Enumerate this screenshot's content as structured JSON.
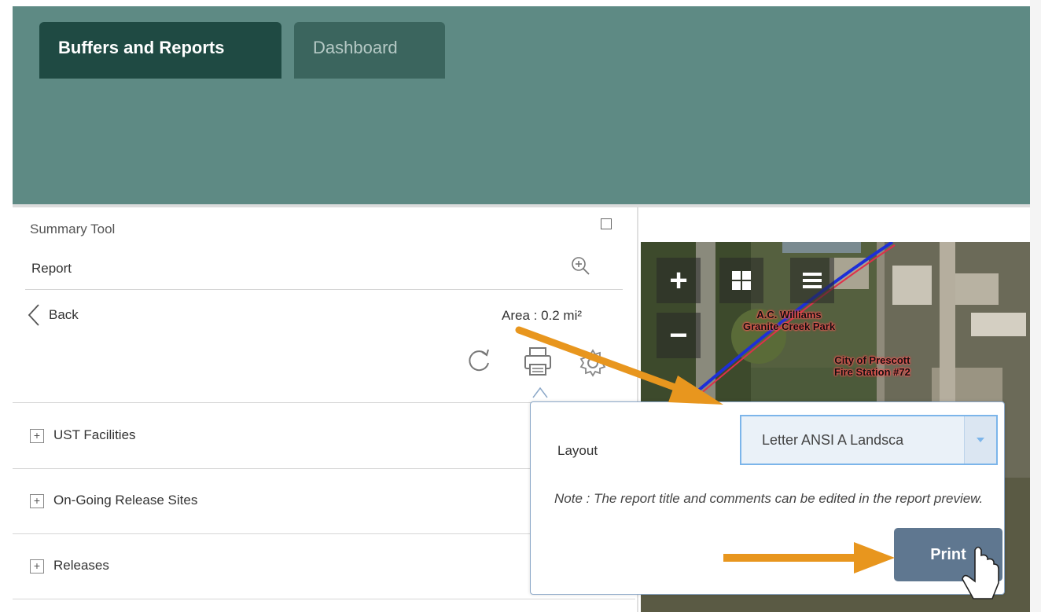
{
  "header": {
    "tabs": [
      {
        "label": "Buffers and Reports",
        "active": true
      },
      {
        "label": "Dashboard",
        "active": false
      }
    ]
  },
  "panel": {
    "title": "Summary Tool",
    "report_label": "Report",
    "back_label": "Back",
    "area_text": "Area : 0.2 mi²",
    "items": [
      {
        "label": "UST Facilities"
      },
      {
        "label": "On-Going Release Sites"
      },
      {
        "label": "Releases"
      }
    ]
  },
  "map": {
    "labels": [
      {
        "text": "A.C. Williams\nGranite Creek Park"
      },
      {
        "text": "City of Prescott\nFire Station #72"
      }
    ],
    "controls": [
      "+",
      "−"
    ]
  },
  "popup": {
    "layout_label": "Layout",
    "layout_value": "Letter ANSI A Landsca",
    "note": "Note : The report title and comments can be edited in the report preview.",
    "print_label": "Print"
  },
  "colors": {
    "header_bg": "#5e8a84",
    "active_tab": "#1f4a43",
    "inactive_tab": "#3b655e",
    "print_button": "#5f7790",
    "annotation_arrow": "#e8961e"
  }
}
